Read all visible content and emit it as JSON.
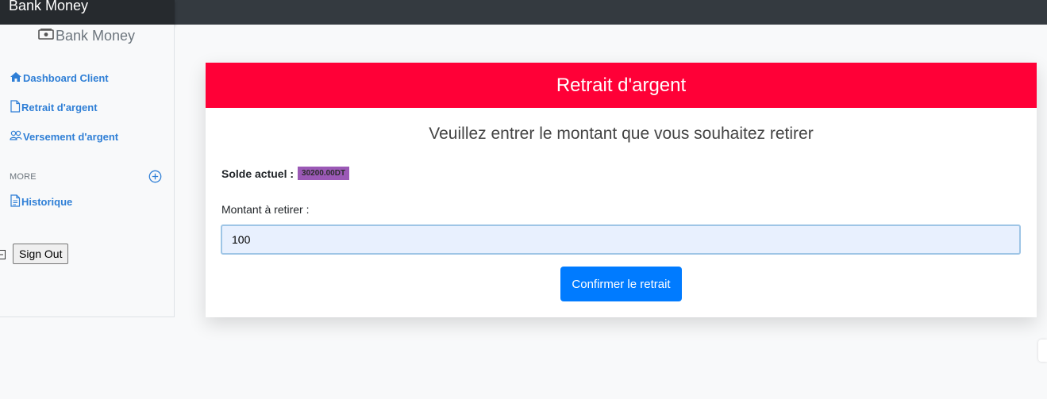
{
  "topbar": {
    "brand": "Bank Money"
  },
  "sidebar": {
    "logo_text": "Bank Money",
    "items": [
      {
        "label": "Dashboard Client",
        "icon": "house-icon"
      },
      {
        "label": "Retrait d'argent",
        "icon": "file-icon"
      },
      {
        "label": "Versement d'argent",
        "icon": "people-icon"
      }
    ],
    "more_label": "MORE",
    "more_items": [
      {
        "label": "Historique",
        "icon": "file-text-icon"
      }
    ],
    "signout_label": "Sign Out"
  },
  "card": {
    "title": "Retrait d'argent",
    "subtitle": "Veuillez entrer le montant que vous souhaitez retirer",
    "balance_label": "Solde actuel :",
    "balance_value": "30200.00DT",
    "amount_label": "Montant à retirer :",
    "amount_value": "100",
    "confirm_label": "Confirmer le retrait"
  },
  "colors": {
    "topbar": "#343a40",
    "header": "#ff0037",
    "link": "#2f7fd6",
    "badge": "#9b59b6",
    "button": "#007bff"
  }
}
